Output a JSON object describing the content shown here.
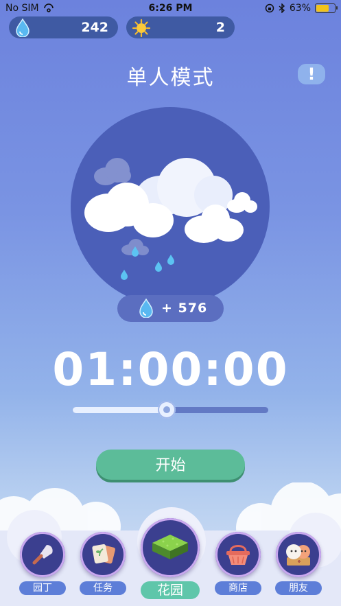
{
  "status_bar": {
    "carrier": "No SIM",
    "time": "6:26 PM",
    "battery_percent": "63%"
  },
  "counters": {
    "water": "242",
    "sun": "2"
  },
  "header": {
    "title": "单人模式",
    "info_icon_text": "!"
  },
  "scene": {
    "reward_amount": "+ 576"
  },
  "timer": {
    "value": "01:00:00",
    "slider_fraction": 0.48
  },
  "actions": {
    "start_label": "开始"
  },
  "nav": {
    "items": [
      {
        "label": "园丁",
        "icon": "trowel-icon"
      },
      {
        "label": "任务",
        "icon": "task-cards-icon"
      },
      {
        "label": "花园",
        "icon": "garden-grass-icon",
        "active": true
      },
      {
        "label": "商店",
        "icon": "basket-icon"
      },
      {
        "label": "朋友",
        "icon": "friends-icon"
      }
    ]
  },
  "colors": {
    "accent_green": "#5cbc99",
    "nav_label_blue": "#5d7ed8",
    "circle": "#4b5fb8"
  }
}
